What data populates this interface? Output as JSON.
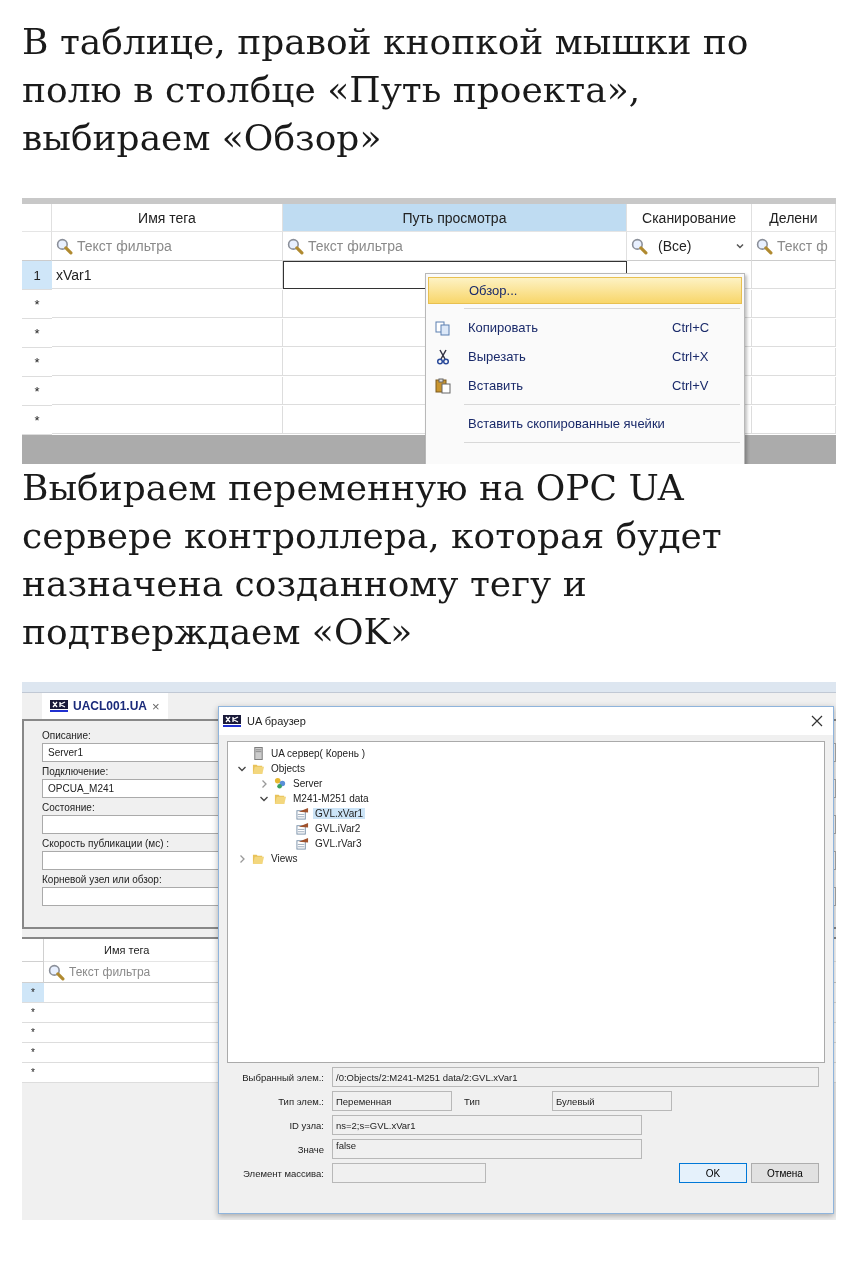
{
  "step_1_text": "В таблице, правой кнопкой мышки по полю в столбце «Путь проекта», выбираем «Обзор»",
  "tag_grid": {
    "columns": [
      {
        "label": "Имя тега",
        "selected": false
      },
      {
        "label": "Путь просмотра",
        "selected": true
      },
      {
        "label": "Сканирование",
        "selected": false
      },
      {
        "label": "Делени",
        "selected": false
      }
    ],
    "filters": [
      {
        "kind": "text",
        "placeholder": "Текст фильтра"
      },
      {
        "kind": "text",
        "placeholder": "Текст фильтра"
      },
      {
        "kind": "dropdown",
        "value": "(Все)"
      },
      {
        "kind": "text",
        "placeholder": "Текст ф"
      }
    ],
    "rows": [
      {
        "marker": "1",
        "name": "xVar1",
        "selected": true
      },
      {
        "marker": "*",
        "selected": false
      },
      {
        "marker": "*",
        "selected": false
      },
      {
        "marker": "*",
        "selected": false
      },
      {
        "marker": "*",
        "selected": false
      },
      {
        "marker": "*",
        "selected": false
      }
    ],
    "context_menu": [
      {
        "kind": "item",
        "label": "Обзор...",
        "selected": true
      },
      {
        "kind": "separator"
      },
      {
        "kind": "item",
        "label": "Копировать",
        "shortcut": "Ctrl+C",
        "selected": false
      },
      {
        "kind": "item",
        "label": "Вырезать",
        "shortcut": "Ctrl+X",
        "selected": false
      },
      {
        "kind": "item",
        "label": "Вставить",
        "shortcut": "Ctrl+V",
        "selected": false
      },
      {
        "kind": "separator"
      },
      {
        "kind": "item",
        "label": "Вставить скопированные ячейки",
        "selected": false
      },
      {
        "kind": "separator"
      }
    ]
  },
  "step_2_text": "Выбираем переменную на OPC UA сервере контроллера, которая будет назначена созданному тегу и подтверждаем «OK»",
  "ua_screen": {
    "tab": {
      "label": "UACL001.UA",
      "close": "×"
    },
    "form": [
      {
        "label": "Описание:",
        "value": "Server1"
      },
      {
        "label": "Подключение:",
        "value": "OPCUA_M241"
      },
      {
        "label": "Состояние:"
      },
      {
        "label": "Скорость публикации (мс) :"
      },
      {
        "label": "Корневой узел или обзор:"
      }
    ],
    "grid": {
      "column": "Имя тега",
      "filter_placeholder": "Текст фильтра",
      "rows": [
        {
          "marker": "*",
          "selected": true
        },
        {
          "marker": "*",
          "selected": false
        },
        {
          "marker": "*",
          "selected": false
        },
        {
          "marker": "*",
          "selected": false
        },
        {
          "marker": "*",
          "selected": false
        }
      ]
    },
    "dialog": {
      "title": "UA браузер",
      "tree": [
        {
          "kind": "server",
          "label": "UA сервер( Корень )",
          "selected": false
        },
        {
          "kind": "folder",
          "label": "Objects",
          "expanded": true,
          "selected": false,
          "children": [
            {
              "kind": "object",
              "label": "Server",
              "expanded": false,
              "selected": false
            },
            {
              "kind": "folder",
              "label": "M241-M251 data",
              "expanded": true,
              "selected": false,
              "children": [
                {
                  "kind": "variable",
                  "label": "GVL.xVar1",
                  "selected": true
                },
                {
                  "kind": "variable",
                  "label": "GVL.iVar2",
                  "selected": false
                },
                {
                  "kind": "variable",
                  "label": "GVL.rVar3",
                  "selected": false
                }
              ]
            }
          ]
        },
        {
          "kind": "folder",
          "label": "Views",
          "expanded": false,
          "selected": false
        }
      ],
      "selected_item": {
        "label": "Выбранный элем.:",
        "value": "/0:Objects/2:M241-M251 data/2:GVL.xVar1"
      },
      "item_type": {
        "label": "Тип элем.:",
        "value": "Переменная"
      },
      "data_type": {
        "label": "Тип",
        "value": "Булевый"
      },
      "node_id": {
        "label": "ID узла:",
        "value": "ns=2;s=GVL.xVar1"
      },
      "value": {
        "label": "Значе",
        "value": "false"
      },
      "array_element": {
        "label": "Элемент массива:"
      },
      "buttons": [
        {
          "label": "OK",
          "default": true
        },
        {
          "label": "Отмена",
          "default": false
        }
      ]
    }
  }
}
